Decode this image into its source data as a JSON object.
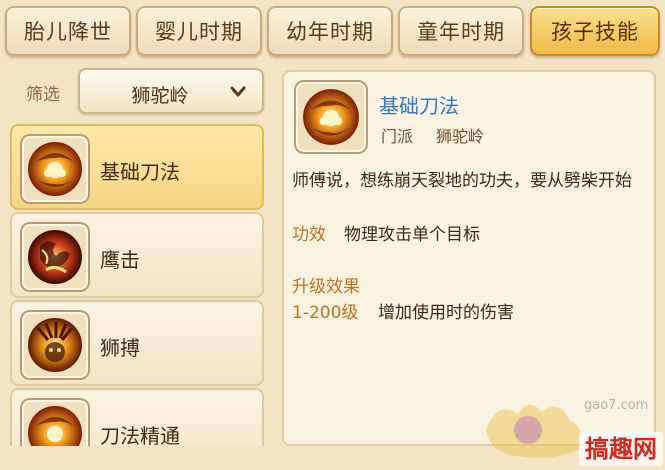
{
  "tabs": [
    {
      "label": "胎儿降世",
      "active": false
    },
    {
      "label": "婴儿时期",
      "active": false
    },
    {
      "label": "幼年时期",
      "active": false
    },
    {
      "label": "童年时期",
      "active": false
    },
    {
      "label": "孩子技能",
      "active": true
    }
  ],
  "filter": {
    "label": "筛选",
    "value": "狮驼岭"
  },
  "skills": [
    {
      "name": "基础刀法",
      "icon": "blade-swirl-icon",
      "selected": true
    },
    {
      "name": "鹰击",
      "icon": "eagle-strike-icon",
      "selected": false
    },
    {
      "name": "狮搏",
      "icon": "lion-pounce-icon",
      "selected": false
    },
    {
      "name": "刀法精通",
      "icon": "blade-mastery-icon",
      "selected": false
    }
  ],
  "detail": {
    "title": "基础刀法",
    "school_label": "门派",
    "school": "狮驼岭",
    "description": "师傅说，想练崩天裂地的功夫，要从劈柴开始",
    "effect_label": "功效",
    "effect": "物理攻击单个目标",
    "upgrade_label": "升级效果",
    "upgrade_range": "1-200级",
    "upgrade_text": "增加使用时的伤害"
  },
  "watermark": {
    "site": "gao7.com",
    "brand": "搞趣网"
  },
  "colors": {
    "accent_tab": "#f0b94a",
    "title_blue": "#2a79c8",
    "label_orange": "#b8731f"
  }
}
